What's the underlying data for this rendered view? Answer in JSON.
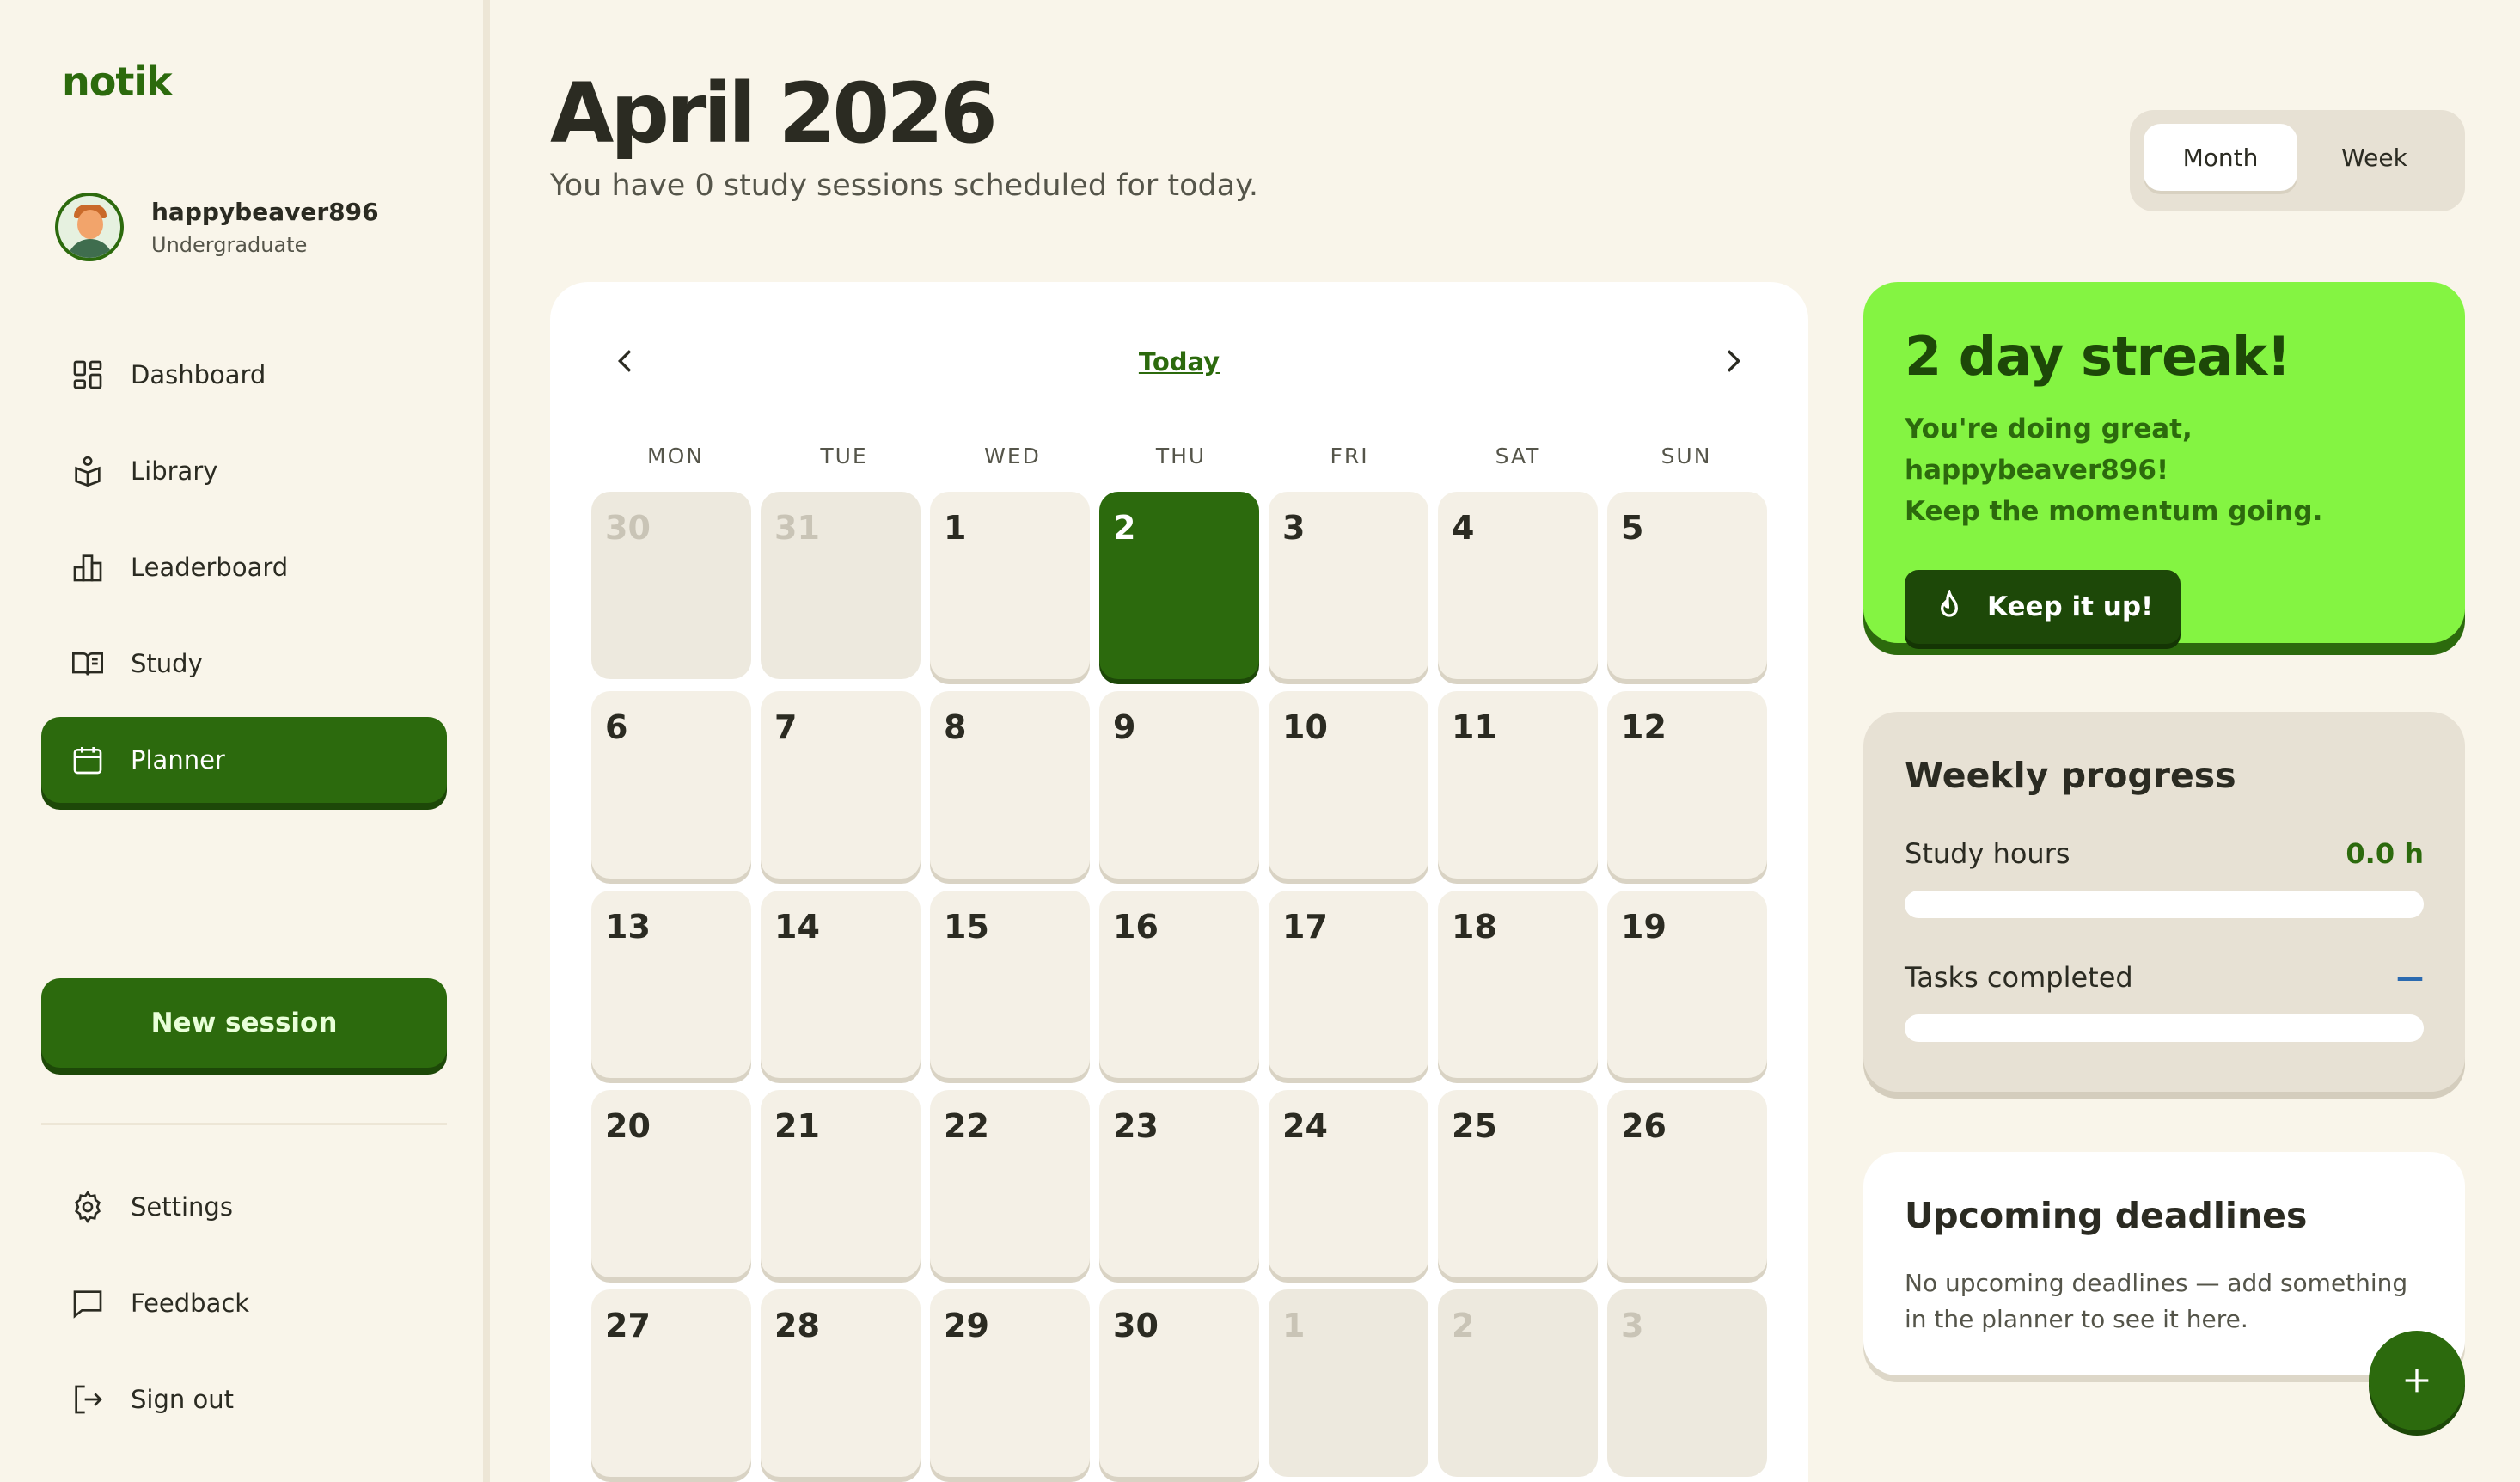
{
  "app": {
    "logo": "notik"
  },
  "user": {
    "name": "happybeaver896",
    "role": "Undergraduate"
  },
  "nav": {
    "items": [
      {
        "label": "Dashboard",
        "icon": "dashboard-icon"
      },
      {
        "label": "Library",
        "icon": "library-icon"
      },
      {
        "label": "Leaderboard",
        "icon": "leaderboard-icon"
      },
      {
        "label": "Study",
        "icon": "book-icon"
      },
      {
        "label": "Planner",
        "icon": "calendar-icon",
        "active": true
      }
    ],
    "new_session_label": "New session",
    "bottom": [
      {
        "label": "Settings",
        "icon": "gear-icon"
      },
      {
        "label": "Feedback",
        "icon": "chat-icon"
      },
      {
        "label": "Sign out",
        "icon": "sign-out-icon"
      }
    ]
  },
  "header": {
    "title": "April 2026",
    "subtitle": "You have 0 study sessions scheduled for today.",
    "view_toggle": {
      "month": "Month",
      "week": "Week",
      "selected": "Month"
    }
  },
  "calendar": {
    "today_label": "Today",
    "weekdays": [
      "MON",
      "TUE",
      "WED",
      "THU",
      "FRI",
      "SAT",
      "SUN"
    ],
    "days": [
      {
        "n": "30",
        "muted": true
      },
      {
        "n": "31",
        "muted": true
      },
      {
        "n": "1"
      },
      {
        "n": "2",
        "today": true
      },
      {
        "n": "3"
      },
      {
        "n": "4"
      },
      {
        "n": "5"
      },
      {
        "n": "6"
      },
      {
        "n": "7"
      },
      {
        "n": "8"
      },
      {
        "n": "9"
      },
      {
        "n": "10"
      },
      {
        "n": "11"
      },
      {
        "n": "12"
      },
      {
        "n": "13"
      },
      {
        "n": "14"
      },
      {
        "n": "15"
      },
      {
        "n": "16"
      },
      {
        "n": "17"
      },
      {
        "n": "18"
      },
      {
        "n": "19"
      },
      {
        "n": "20"
      },
      {
        "n": "21"
      },
      {
        "n": "22"
      },
      {
        "n": "23"
      },
      {
        "n": "24"
      },
      {
        "n": "25"
      },
      {
        "n": "26"
      },
      {
        "n": "27"
      },
      {
        "n": "28"
      },
      {
        "n": "29"
      },
      {
        "n": "30"
      },
      {
        "n": "1",
        "muted": true
      },
      {
        "n": "2",
        "muted": true
      },
      {
        "n": "3",
        "muted": true
      }
    ]
  },
  "streak": {
    "title": "2 day streak!",
    "line1": "You're doing great, happybeaver896!",
    "line2": "Keep the momentum going.",
    "button_label": "Keep it up!",
    "button_icon": "flame-icon"
  },
  "weekly_progress": {
    "title": "Weekly progress",
    "study_hours_label": "Study hours",
    "study_hours_value": "0.0 h",
    "study_hours_fraction": 0,
    "tasks_label": "Tasks completed",
    "tasks_value": "—",
    "tasks_fraction": 0
  },
  "deadlines": {
    "title": "Upcoming deadlines",
    "empty_text": "No upcoming deadlines — add something in the planner to see it here."
  },
  "colors": {
    "brand": "#2c6a0d",
    "brand_dark": "#1d4808",
    "streak_bg": "#84f442",
    "background": "#f9f5ea"
  }
}
